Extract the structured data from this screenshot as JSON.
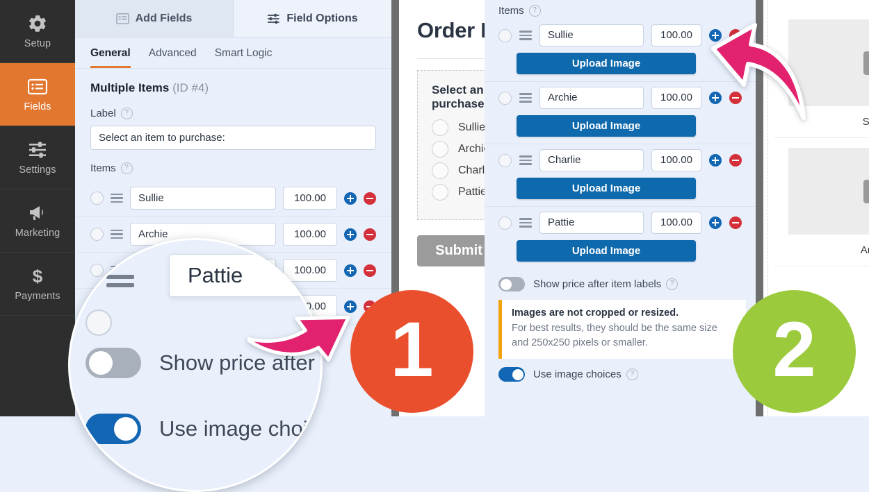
{
  "sidebar": {
    "items": [
      {
        "label": "Setup",
        "icon": "gear-icon",
        "active": false
      },
      {
        "label": "Fields",
        "icon": "list-icon",
        "active": true
      },
      {
        "label": "Settings",
        "icon": "sliders-icon",
        "active": false
      },
      {
        "label": "Marketing",
        "icon": "megaphone-icon",
        "active": false
      },
      {
        "label": "Payments",
        "icon": "dollar-icon",
        "active": false
      }
    ]
  },
  "options_panel": {
    "tabs": [
      {
        "label": "Add Fields",
        "icon": "add-fields-icon",
        "active": false
      },
      {
        "label": "Field Options",
        "icon": "field-options-icon",
        "active": true
      }
    ],
    "subtabs": [
      {
        "label": "General",
        "active": true
      },
      {
        "label": "Advanced",
        "active": false
      },
      {
        "label": "Smart Logic",
        "active": false
      }
    ],
    "field_title": "Multiple Items",
    "field_id": "(ID #4)",
    "label_group": {
      "label": "Label",
      "help": "?",
      "value": "Select an item to purchase:"
    },
    "items_group": {
      "label": "Items",
      "help": "?",
      "rows": [
        {
          "name": "Sullie",
          "price": "100.00"
        },
        {
          "name": "Archie",
          "price": "100.00"
        },
        {
          "name": "Charlie",
          "price": "100.00"
        },
        {
          "name": "Pattie",
          "price": "100.00"
        }
      ]
    },
    "toggles": [
      {
        "label": "Show price after item labels",
        "state": "off"
      },
      {
        "label": "Use image choices",
        "state": "on"
      }
    ]
  },
  "magnifier": {
    "field_value": "Pattie",
    "toggle_show_price": "Show price after item",
    "toggle_show_price_state": "off",
    "toggle_use_images": "Use image choices",
    "toggle_use_images_state": "on"
  },
  "preview": {
    "form_title": "Order Form",
    "question_label": "Select an item to purchase:",
    "choices": [
      "Sullie",
      "Archie",
      "Charlie",
      "Pattie"
    ],
    "submit_label": "Submit"
  },
  "right_panel": {
    "items_label": "Items",
    "items_help": "?",
    "rows": [
      {
        "name": "Sullie",
        "price": "100.00",
        "upload_label": "Upload Image"
      },
      {
        "name": "Archie",
        "price": "100.00",
        "upload_label": "Upload Image"
      },
      {
        "name": "Charlie",
        "price": "100.00",
        "upload_label": "Upload Image"
      },
      {
        "name": "Pattie",
        "price": "100.00",
        "upload_label": "Upload Image"
      }
    ],
    "show_price_label": "Show price after item labels",
    "show_price_state": "off",
    "show_price_help": "?",
    "notice_title": "Images are not cropped or resized.",
    "notice_body": "For best results, they should be the same size and 250x250 pixels or smaller.",
    "use_images_label": "Use image choices",
    "use_images_state": "on",
    "use_images_help": "?"
  },
  "image_preview": {
    "cards": [
      {
        "caption": "Sullie",
        "icon": "image-placeholder-icon"
      },
      {
        "caption": "Archie",
        "icon": "image-placeholder-icon"
      }
    ]
  },
  "callouts": {
    "badge_one": "1",
    "badge_two": "2"
  },
  "colors": {
    "sidebar_active": "#e27730",
    "panel_bg": "#e9f0fb",
    "primary_blue": "#0f69ad",
    "add_blue": "#1266b3",
    "remove_red": "#d3303a",
    "notice_accent": "#f2a30f",
    "badge_one_bg": "#ea4f2d",
    "badge_two_bg": "#9bca3c",
    "arrow_pink": "#e2226e"
  }
}
